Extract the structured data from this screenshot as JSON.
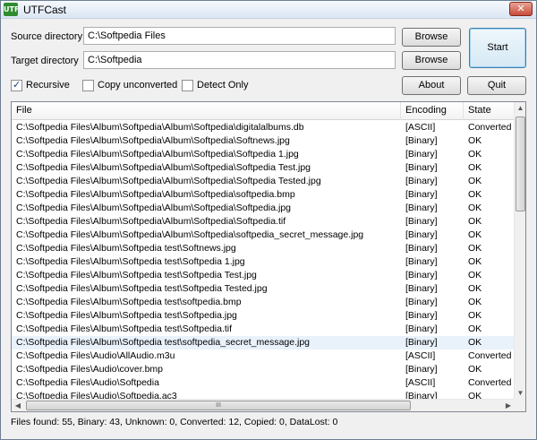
{
  "window": {
    "title": "UTFCast",
    "icon_label": "UTF",
    "close_glyph": "✕"
  },
  "form": {
    "source_label": "Source directory",
    "source_value": "C:\\Softpedia Files",
    "target_label": "Target directory",
    "target_value": "C:\\Softpedia",
    "browse_label": "Browse",
    "start_label": "Start",
    "about_label": "About",
    "quit_label": "Quit"
  },
  "options": {
    "recursive": {
      "label": "Recursive",
      "checked": true
    },
    "copy_unconverted": {
      "label": "Copy unconverted",
      "checked": false
    },
    "detect_only": {
      "label": "Detect Only",
      "checked": false
    }
  },
  "list": {
    "columns": [
      "File",
      "Encoding",
      "State"
    ],
    "rows": [
      {
        "file": "C:\\Softpedia Files\\Album\\Softpedia\\Album\\Softpedia\\digitalalbums.db",
        "encoding": "[ASCII]",
        "state": "Converted"
      },
      {
        "file": "C:\\Softpedia Files\\Album\\Softpedia\\Album\\Softpedia\\Softnews.jpg",
        "encoding": "[Binary]",
        "state": "OK"
      },
      {
        "file": "C:\\Softpedia Files\\Album\\Softpedia\\Album\\Softpedia\\Softpedia 1.jpg",
        "encoding": "[Binary]",
        "state": "OK"
      },
      {
        "file": "C:\\Softpedia Files\\Album\\Softpedia\\Album\\Softpedia\\Softpedia Test.jpg",
        "encoding": "[Binary]",
        "state": "OK"
      },
      {
        "file": "C:\\Softpedia Files\\Album\\Softpedia\\Album\\Softpedia\\Softpedia Tested.jpg",
        "encoding": "[Binary]",
        "state": "OK"
      },
      {
        "file": "C:\\Softpedia Files\\Album\\Softpedia\\Album\\Softpedia\\softpedia.bmp",
        "encoding": "[Binary]",
        "state": "OK"
      },
      {
        "file": "C:\\Softpedia Files\\Album\\Softpedia\\Album\\Softpedia\\Softpedia.jpg",
        "encoding": "[Binary]",
        "state": "OK"
      },
      {
        "file": "C:\\Softpedia Files\\Album\\Softpedia\\Album\\Softpedia\\Softpedia.tif",
        "encoding": "[Binary]",
        "state": "OK"
      },
      {
        "file": "C:\\Softpedia Files\\Album\\Softpedia\\Album\\Softpedia\\softpedia_secret_message.jpg",
        "encoding": "[Binary]",
        "state": "OK"
      },
      {
        "file": "C:\\Softpedia Files\\Album\\Softpedia test\\Softnews.jpg",
        "encoding": "[Binary]",
        "state": "OK"
      },
      {
        "file": "C:\\Softpedia Files\\Album\\Softpedia test\\Softpedia 1.jpg",
        "encoding": "[Binary]",
        "state": "OK"
      },
      {
        "file": "C:\\Softpedia Files\\Album\\Softpedia test\\Softpedia Test.jpg",
        "encoding": "[Binary]",
        "state": "OK"
      },
      {
        "file": "C:\\Softpedia Files\\Album\\Softpedia test\\Softpedia Tested.jpg",
        "encoding": "[Binary]",
        "state": "OK"
      },
      {
        "file": "C:\\Softpedia Files\\Album\\Softpedia test\\softpedia.bmp",
        "encoding": "[Binary]",
        "state": "OK"
      },
      {
        "file": "C:\\Softpedia Files\\Album\\Softpedia test\\Softpedia.jpg",
        "encoding": "[Binary]",
        "state": "OK"
      },
      {
        "file": "C:\\Softpedia Files\\Album\\Softpedia test\\Softpedia.tif",
        "encoding": "[Binary]",
        "state": "OK"
      },
      {
        "file": "C:\\Softpedia Files\\Album\\Softpedia test\\softpedia_secret_message.jpg",
        "encoding": "[Binary]",
        "state": "OK",
        "selected": true
      },
      {
        "file": "C:\\Softpedia Files\\Audio\\AllAudio.m3u",
        "encoding": "[ASCII]",
        "state": "Converted"
      },
      {
        "file": "C:\\Softpedia Files\\Audio\\cover.bmp",
        "encoding": "[Binary]",
        "state": "OK"
      },
      {
        "file": "C:\\Softpedia Files\\Audio\\Softpedia",
        "encoding": "[ASCII]",
        "state": "Converted"
      },
      {
        "file": "C:\\Softpedia Files\\Audio\\Softpedia.ac3",
        "encoding": "[Binary]",
        "state": "OK"
      }
    ],
    "hscroll_grip": "III"
  },
  "status": {
    "text": "Files found: 55, Binary: 43, Unknown: 0, Converted: 12, Copied: 0, DataLost: 0"
  }
}
